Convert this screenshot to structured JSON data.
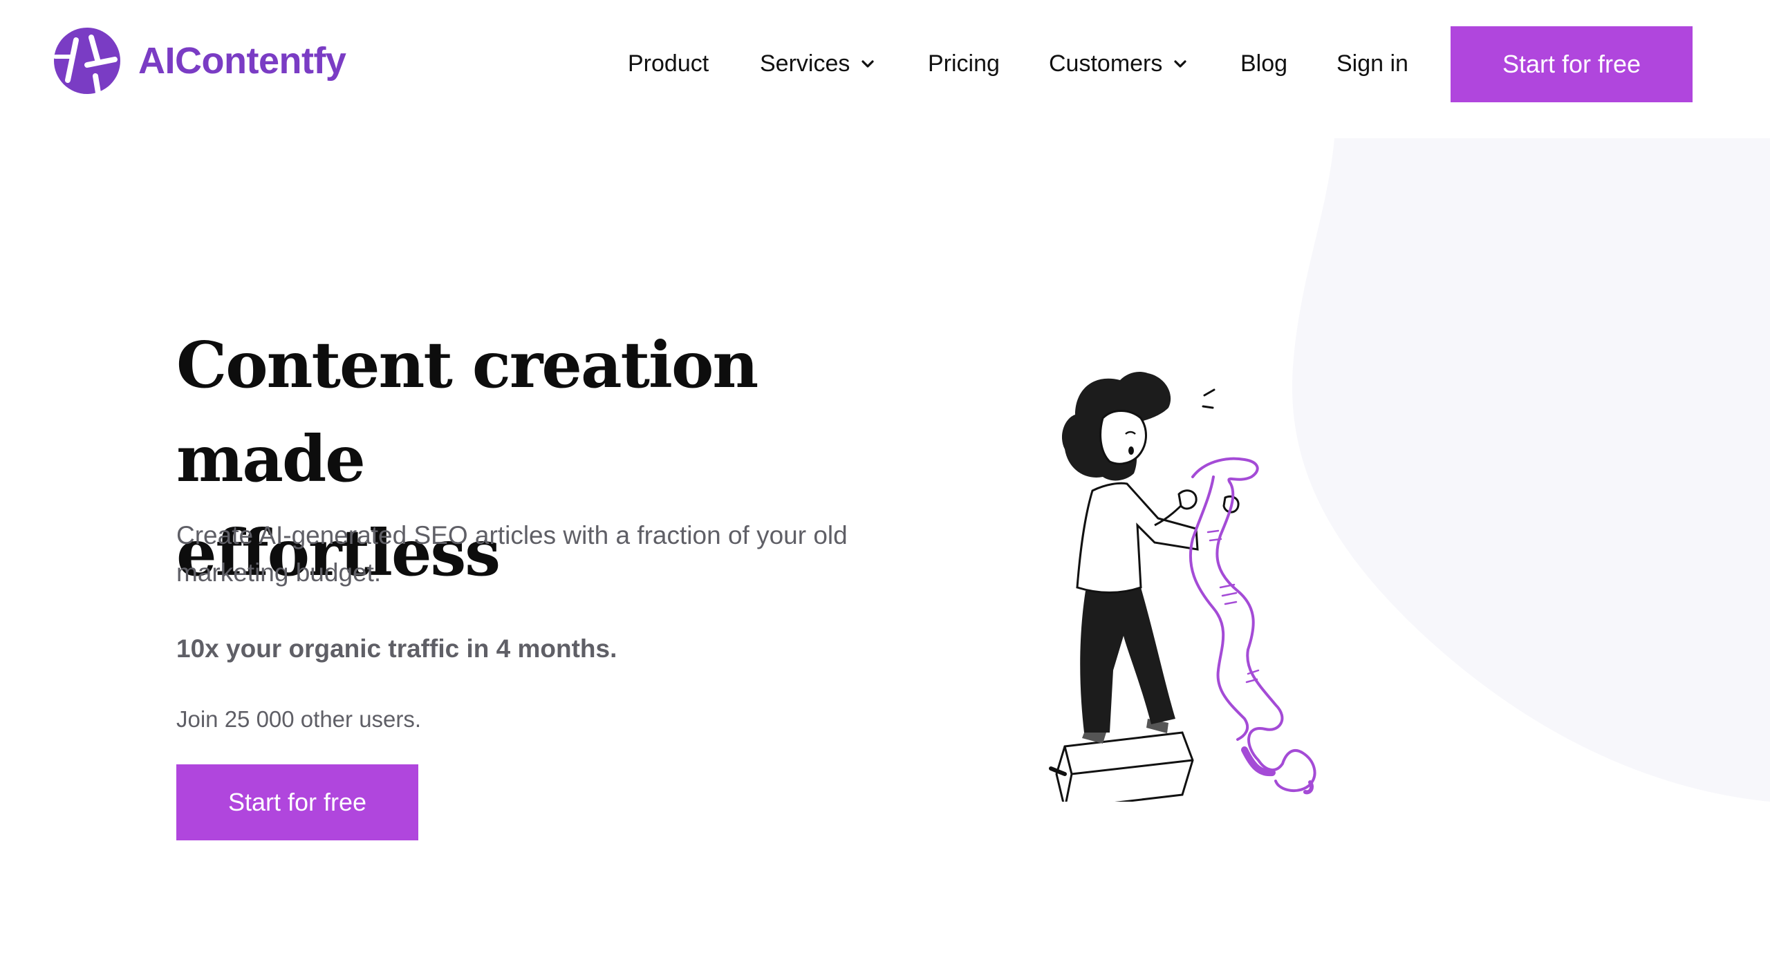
{
  "brand": {
    "name": "AIContentfy",
    "accent": "#b046dd",
    "logo_color": "#7a3cc4"
  },
  "nav": {
    "items": [
      {
        "label": "Product",
        "has_dropdown": false
      },
      {
        "label": "Services",
        "has_dropdown": true
      },
      {
        "label": "Pricing",
        "has_dropdown": false
      },
      {
        "label": "Customers",
        "has_dropdown": true
      },
      {
        "label": "Blog",
        "has_dropdown": false
      },
      {
        "label": "Sign in",
        "has_dropdown": false
      }
    ],
    "cta_label": "Start for free"
  },
  "hero": {
    "title_line1": "Content creation made",
    "title_line2": "effortless",
    "subtitle": "Create AI-generated SEO articles with a fraction of your old marketing budget.",
    "highlight": "10x your organic traffic in 4 months.",
    "social_proof": "Join 25 000 other users.",
    "cta_label": "Start for free"
  },
  "icons": {
    "logo": "aicontentfy-logo-icon",
    "dropdown": "chevron-down-icon",
    "illustration": "woman-reading-scroll-illustration"
  }
}
